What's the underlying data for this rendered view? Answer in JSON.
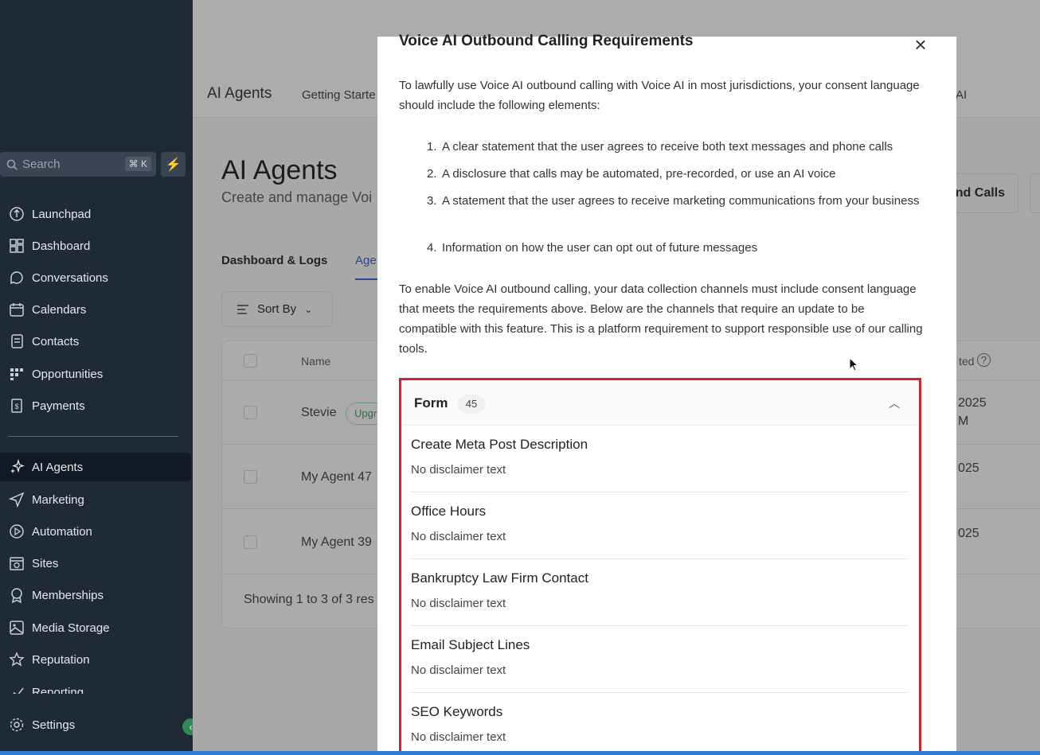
{
  "sidebar": {
    "search_placeholder": "Search",
    "search_shortcut": "⌘ K",
    "items": [
      {
        "label": "Launchpad",
        "icon": "launchpad-icon"
      },
      {
        "label": "Dashboard",
        "icon": "dashboard-icon"
      },
      {
        "label": "Conversations",
        "icon": "conversations-icon"
      },
      {
        "label": "Calendars",
        "icon": "calendar-icon"
      },
      {
        "label": "Contacts",
        "icon": "contacts-icon"
      },
      {
        "label": "Opportunities",
        "icon": "opportunities-icon"
      },
      {
        "label": "Payments",
        "icon": "payments-icon"
      },
      {
        "label": "AI Agents",
        "icon": "sparkle-icon",
        "active": true
      },
      {
        "label": "Marketing",
        "icon": "send-icon"
      },
      {
        "label": "Automation",
        "icon": "automation-icon"
      },
      {
        "label": "Sites",
        "icon": "sites-icon"
      },
      {
        "label": "Memberships",
        "icon": "memberships-icon"
      },
      {
        "label": "Media Storage",
        "icon": "image-icon"
      },
      {
        "label": "Reputation",
        "icon": "star-icon"
      },
      {
        "label": "Reporting",
        "icon": "reporting-icon"
      }
    ],
    "settings_label": "Settings"
  },
  "topbar": {
    "title": "AI Agents",
    "tab_getting_started": "Getting Starte",
    "tab_right": "AI"
  },
  "main": {
    "title": "AI Agents",
    "subtitle": "Create and manage Voi",
    "tab_dashboard": "Dashboard & Logs",
    "tab_agents": "Age",
    "sort_by": "Sort By",
    "button_calls": "nd Calls",
    "table": {
      "header_name": "Name",
      "header_updated": "ted",
      "rows": [
        {
          "name": "Stevie",
          "badge": "Upgr",
          "date": "2025",
          "time": "M"
        },
        {
          "name": "My Agent 47",
          "date": "025"
        },
        {
          "name": "My Agent 39",
          "date": "025"
        }
      ],
      "footer": "Showing 1 to 3 of 3 res"
    }
  },
  "modal": {
    "title": "Voice AI Outbound Calling Requirements",
    "intro": "To lawfully use Voice AI outbound calling with Voice AI in most jurisdictions, your consent language should include the following elements:",
    "requirements": [
      "A clear statement that the user agrees to receive both text messages and phone calls",
      "A disclosure that calls may be automated, pre-recorded, or use an AI voice",
      "A statement that the user agrees to receive marketing communications from your business",
      "Information on how the user can opt out of future messages"
    ],
    "body": "To enable Voice AI outbound calling, your data collection channels must include consent language that meets the requirements above. Below are the channels that require an update to be compatible with this feature. This is a platform requirement to support responsible use of our calling tools.",
    "form_section": {
      "label": "Form",
      "count": "45",
      "items": [
        {
          "name": "Create Meta Post Description",
          "desc": "No disclaimer text"
        },
        {
          "name": "Office Hours",
          "desc": "No disclaimer text"
        },
        {
          "name": "Bankruptcy Law Firm Contact",
          "desc": "No disclaimer text"
        },
        {
          "name": "Email Subject Lines",
          "desc": "No disclaimer text"
        },
        {
          "name": "SEO Keywords",
          "desc": "No disclaimer text"
        }
      ]
    }
  },
  "colors": {
    "sidebar_bg": "#1f2a37",
    "highlight_border": "#d0262b",
    "accent_green": "#3fca72"
  }
}
